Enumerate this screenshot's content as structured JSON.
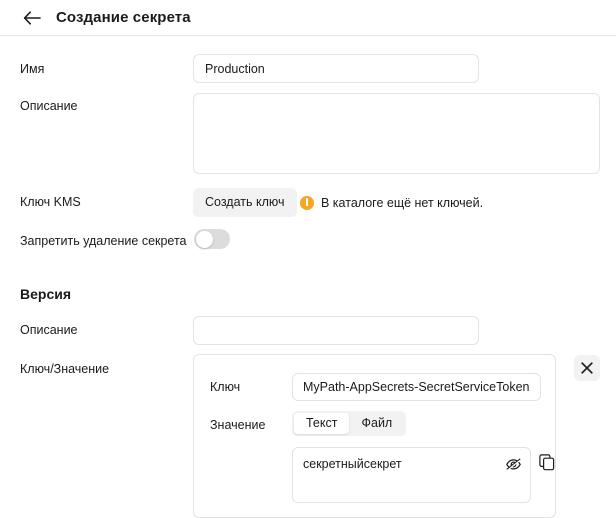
{
  "header": {
    "back_icon": "arrow-left-icon",
    "title": "Создание секрета"
  },
  "main": {
    "name": {
      "label": "Имя",
      "value": "Production",
      "placeholder": ""
    },
    "description": {
      "label": "Описание",
      "value": "",
      "placeholder": ""
    },
    "kms_key": {
      "label": "Ключ KMS",
      "button_label": "Создать ключ",
      "warning_icon": "warning-circle-icon",
      "warning_text": "В каталоге ещё нет ключей."
    },
    "deletion_protection": {
      "label": "Запретить удаление секрета",
      "enabled": false
    }
  },
  "version": {
    "section_title": "Версия",
    "description": {
      "label": "Описание",
      "value": "",
      "placeholder": ""
    },
    "key_value": {
      "label": "Ключ/Значение",
      "key": {
        "label": "Ключ",
        "value": "MyPath-AppSecrets-SecretServiceToken",
        "placeholder": ""
      },
      "value": {
        "label": "Значение",
        "segments": [
          {
            "label": "Текст",
            "selected": true
          },
          {
            "label": "Файл",
            "selected": false
          }
        ],
        "text": "секретныйсекрет",
        "placeholder": "",
        "hide_icon": "eye-slash-icon",
        "copy_icon": "copy-icon"
      },
      "remove_icon": "close-icon"
    }
  },
  "colors": {
    "accent_warning": "#f5a623",
    "border": "#e3e3e3",
    "surface_muted": "#f2f2f2",
    "text": "#1b1b1b"
  }
}
